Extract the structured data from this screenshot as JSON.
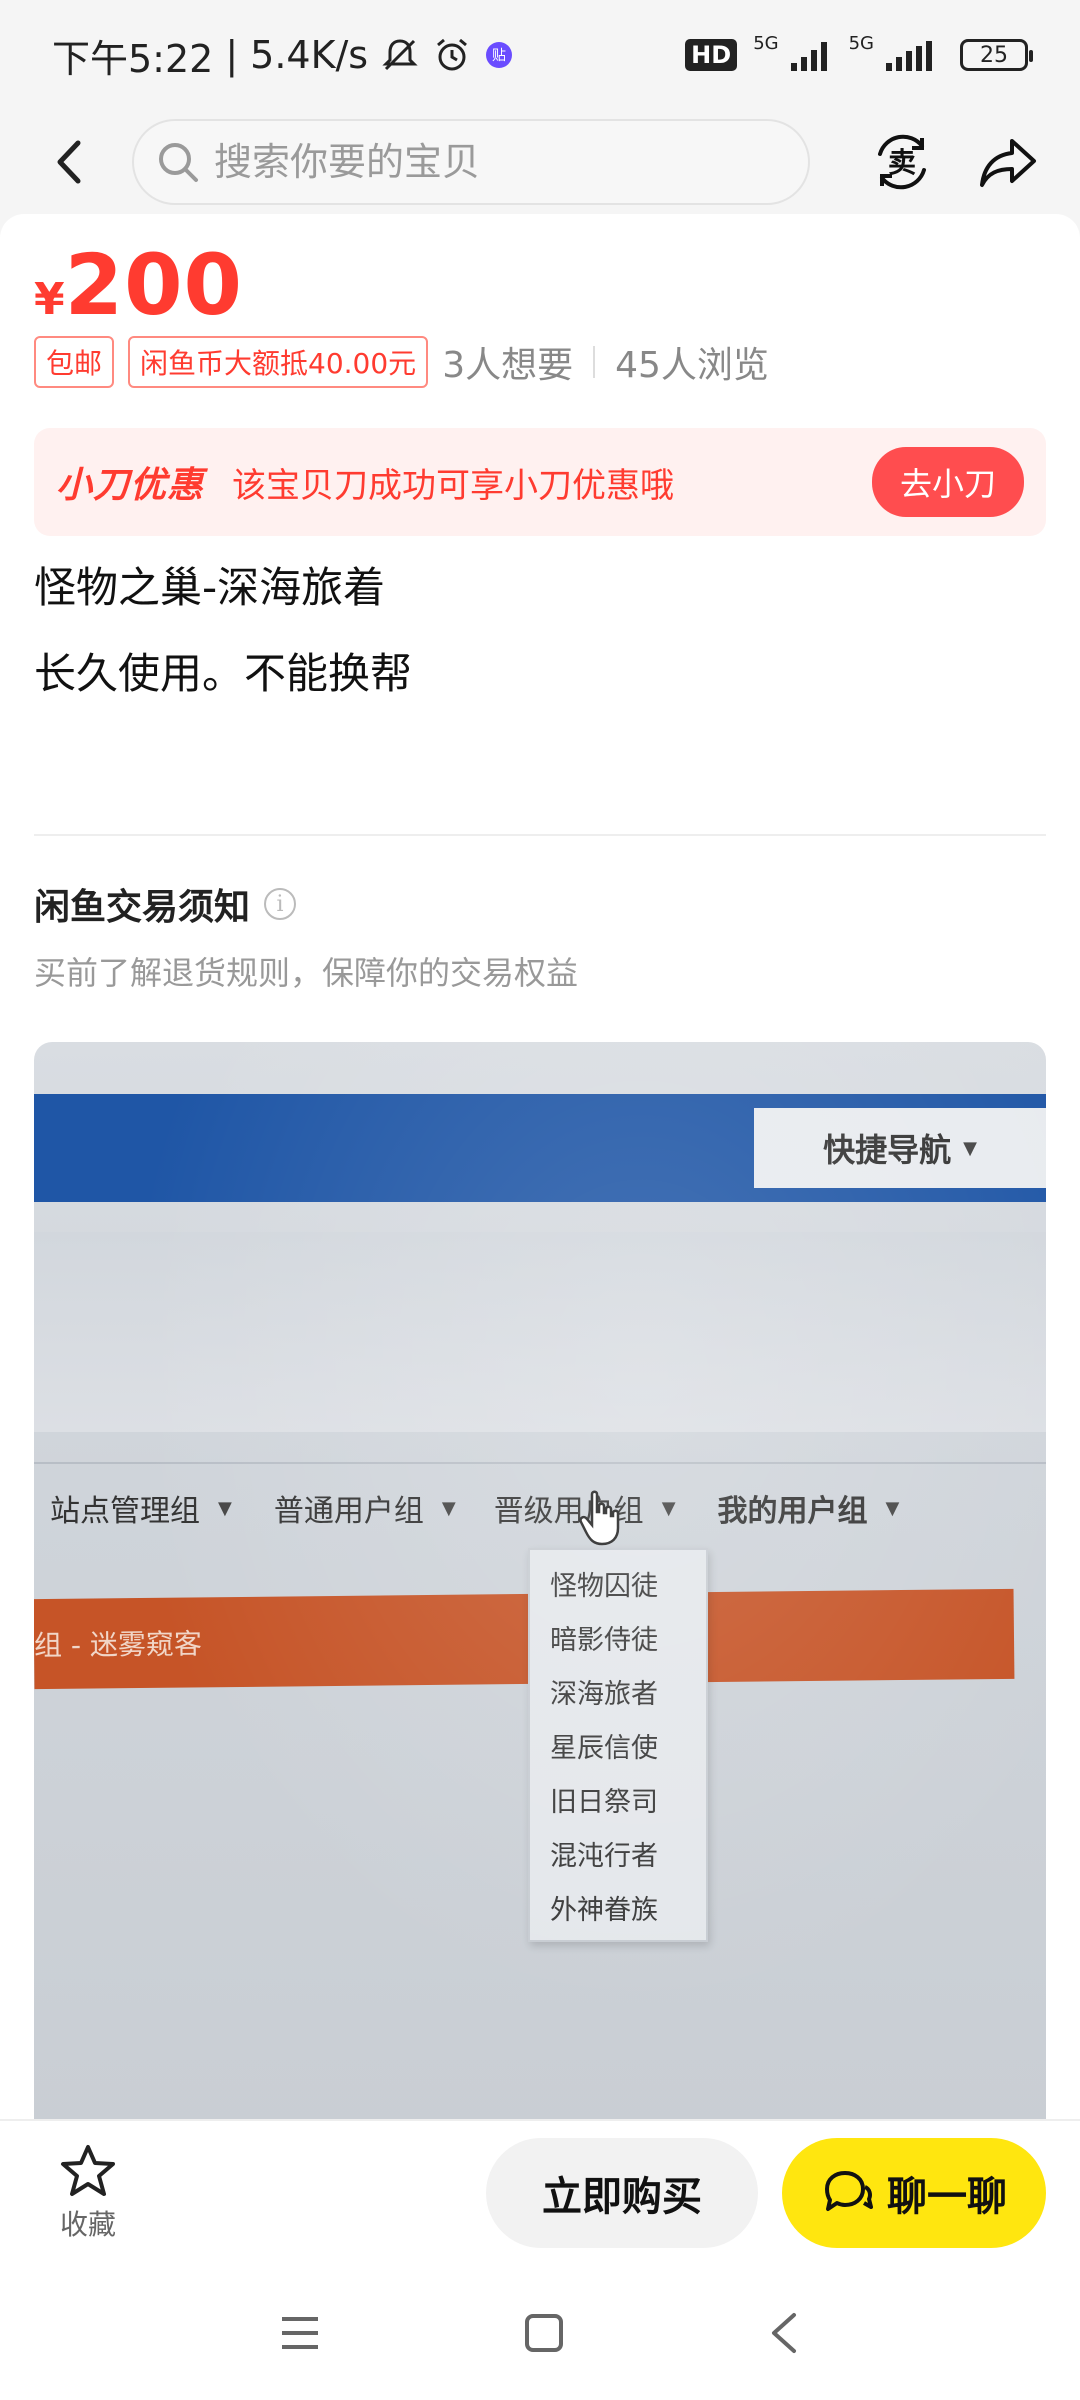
{
  "status_bar": {
    "time": "下午5:22",
    "speed": "5.4K/s",
    "network_badge": "HD",
    "signal1_label": "5G",
    "signal2_label": "5G",
    "battery": "25"
  },
  "nav": {
    "search_placeholder": "搜索你要的宝贝",
    "sell_icon_label": "卖"
  },
  "product": {
    "currency": "¥",
    "price": "200",
    "tags": [
      "包邮",
      "闲鱼币大额抵40.00元"
    ],
    "want_count": "3人想要",
    "view_count": "45人浏览",
    "title": "怪物之巢-深海旅着",
    "description": "长久使用。不能换帮"
  },
  "promo": {
    "brand": "小刀优惠",
    "text": "该宝贝刀成功可享小刀优惠哦",
    "button": "去小刀"
  },
  "notice": {
    "title": "闲鱼交易须知",
    "subtitle": "买前了解退货规则，保障你的交易权益"
  },
  "photo": {
    "quick_nav": "快捷导航",
    "menu": [
      "站点管理组",
      "普通用户组",
      "晋级用户组",
      "我的用户组"
    ],
    "banner_text": "组 - 迷雾窥客",
    "dropdown": [
      "怪物囚徒",
      "暗影侍徒",
      "深海旅者",
      "星辰信使",
      "旧日祭司",
      "混沌行者",
      "外神眷族"
    ]
  },
  "bottom": {
    "favorite": "收藏",
    "buy": "立即购买",
    "chat": "聊一聊"
  },
  "colors": {
    "price_red": "#ff3b30",
    "chat_yellow": "#ffe60f"
  }
}
